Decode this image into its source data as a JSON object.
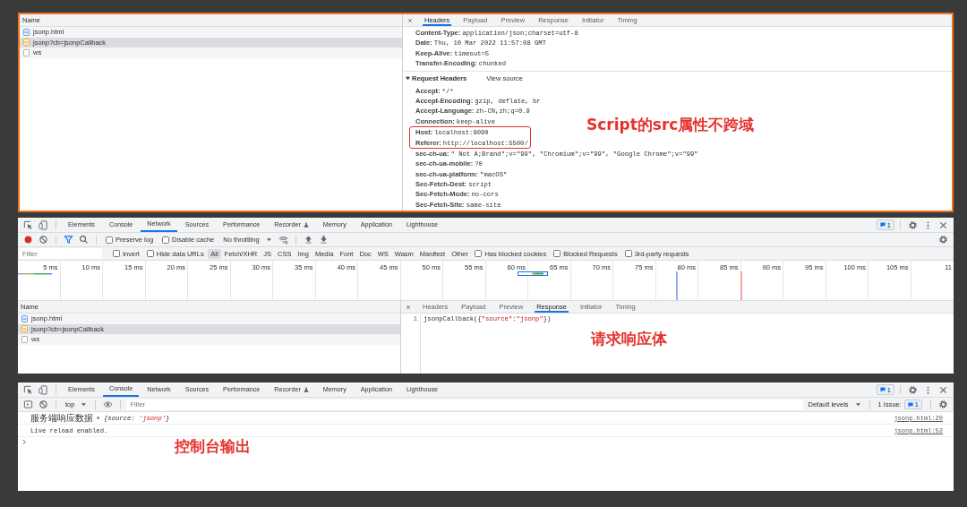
{
  "top_panel": {
    "requests": {
      "column": "Name",
      "items": [
        {
          "name": "jsonp.html",
          "kind": "document",
          "selected": false
        },
        {
          "name": "jsonp?cb=jsonpCallback",
          "kind": "script",
          "selected": true
        },
        {
          "name": "ws",
          "kind": "other",
          "selected": false
        }
      ]
    },
    "detail": {
      "tabs": [
        {
          "label": "Headers",
          "selected": true
        },
        {
          "label": "Payload",
          "selected": false
        },
        {
          "label": "Preview",
          "selected": false
        },
        {
          "label": "Response",
          "selected": false
        },
        {
          "label": "Initiator",
          "selected": false
        },
        {
          "label": "Timing",
          "selected": false
        }
      ],
      "response_headers": [
        {
          "name": "Content-Type:",
          "value": "application/json;charset=utf-8"
        },
        {
          "name": "Date:",
          "value": "Thu, 10 Mar 2022 11:57:08 GMT"
        },
        {
          "name": "Keep-Alive:",
          "value": "timeout=5"
        },
        {
          "name": "Transfer-Encoding:",
          "value": "chunked"
        }
      ],
      "request_headers": {
        "title": "Request Headers",
        "expanded": true,
        "view_source": "View source",
        "items": [
          {
            "name": "Accept:",
            "value": "*/*",
            "highlighted": false
          },
          {
            "name": "Accept-Encoding:",
            "value": "gzip, deflate, br",
            "highlighted": false
          },
          {
            "name": "Accept-Language:",
            "value": "zh-CN,zh;q=0.9",
            "highlighted": false
          },
          {
            "name": "Connection:",
            "value": "keep-alive",
            "highlighted": false
          },
          {
            "name": "Host:",
            "value": "localhost:8090",
            "highlighted": true
          },
          {
            "name": "Referer:",
            "value": "http://localhost:5500/",
            "highlighted": true
          },
          {
            "name": "sec-ch-ua:",
            "value": "\" Not A;Brand\";v=\"99\", \"Chromium\";v=\"99\", \"Google Chrome\";v=\"99\"",
            "highlighted": false
          },
          {
            "name": "sec-ch-ua-mobile:",
            "value": "?0",
            "highlighted": false
          },
          {
            "name": "sec-ch-ua-platform:",
            "value": "\"macOS\"",
            "highlighted": false
          },
          {
            "name": "Sec-Fetch-Dest:",
            "value": "script",
            "highlighted": false
          },
          {
            "name": "Sec-Fetch-Mode:",
            "value": "no-cors",
            "highlighted": false
          },
          {
            "name": "Sec-Fetch-Site:",
            "value": "same-site",
            "highlighted": false
          }
        ]
      }
    },
    "annotation": "Script的src属性不跨域"
  },
  "network_panel": {
    "devtools_tabs": [
      {
        "label": "Elements",
        "selected": false,
        "experimental": false
      },
      {
        "label": "Console",
        "selected": false,
        "experimental": false
      },
      {
        "label": "Network",
        "selected": true,
        "experimental": false
      },
      {
        "label": "Sources",
        "selected": false,
        "experimental": false
      },
      {
        "label": "Performance",
        "selected": false,
        "experimental": false
      },
      {
        "label": "Recorder",
        "selected": false,
        "experimental": true
      },
      {
        "label": "Memory",
        "selected": false,
        "experimental": false
      },
      {
        "label": "Application",
        "selected": false,
        "experimental": false
      },
      {
        "label": "Lighthouse",
        "selected": false,
        "experimental": false
      }
    ],
    "issues_count": "1",
    "toolbar": {
      "recording": true,
      "checkboxes": [
        {
          "label": "Preserve log",
          "checked": false
        },
        {
          "label": "Disable cache",
          "checked": false
        }
      ],
      "throttling": "No throttling"
    },
    "filter_bar": {
      "placeholder": "Filter",
      "options_before": [
        {
          "label": "Invert",
          "checked": false
        },
        {
          "label": "Hide data URLs",
          "checked": false
        }
      ],
      "types": [
        {
          "label": "All",
          "selected": true
        },
        {
          "label": "Fetch/XHR",
          "selected": false
        },
        {
          "label": "JS",
          "selected": false
        },
        {
          "label": "CSS",
          "selected": false
        },
        {
          "label": "Img",
          "selected": false
        },
        {
          "label": "Media",
          "selected": false
        },
        {
          "label": "Font",
          "selected": false
        },
        {
          "label": "Doc",
          "selected": false
        },
        {
          "label": "WS",
          "selected": false
        },
        {
          "label": "Wasm",
          "selected": false
        },
        {
          "label": "Manifest",
          "selected": false
        },
        {
          "label": "Other",
          "selected": false
        }
      ],
      "options_after": [
        {
          "label": "Has blocked cookies",
          "checked": false
        },
        {
          "label": "Blocked Requests",
          "checked": false
        },
        {
          "label": "3rd-party requests",
          "checked": false
        }
      ]
    },
    "timeline": {
      "ticks": [
        "5 ms",
        "10 ms",
        "15 ms",
        "20 ms",
        "25 ms",
        "30 ms",
        "35 ms",
        "40 ms",
        "45 ms",
        "50 ms",
        "55 ms",
        "60 ms",
        "65 ms",
        "70 ms",
        "75 ms",
        "80 ms",
        "85 ms",
        "90 ms",
        "95 ms",
        "100 ms",
        "105 ms",
        "11"
      ]
    },
    "requests": {
      "column": "Name",
      "items": [
        {
          "name": "jsonp.html",
          "kind": "document",
          "selected": false
        },
        {
          "name": "jsonp?cb=jsonpCallback",
          "kind": "script",
          "selected": true
        },
        {
          "name": "ws",
          "kind": "other",
          "selected": false
        }
      ]
    },
    "detail": {
      "tabs": [
        {
          "label": "Headers",
          "selected": false
        },
        {
          "label": "Payload",
          "selected": false
        },
        {
          "label": "Preview",
          "selected": false
        },
        {
          "label": "Response",
          "selected": true
        },
        {
          "label": "Initiator",
          "selected": false
        },
        {
          "label": "Timing",
          "selected": false
        }
      ],
      "line_number": "1",
      "code": [
        {
          "text": "jsonpCallback({",
          "kind": "plain"
        },
        {
          "text": "\"source\"",
          "kind": "string"
        },
        {
          "text": ":",
          "kind": "plain"
        },
        {
          "text": "\"jsonp\"",
          "kind": "string"
        },
        {
          "text": "})",
          "kind": "plain"
        }
      ]
    },
    "annotation": "请求响应体"
  },
  "console_panel": {
    "devtools_tabs": [
      {
        "label": "Elements",
        "selected": false,
        "experimental": false
      },
      {
        "label": "Console",
        "selected": true,
        "experimental": false
      },
      {
        "label": "Network",
        "selected": false,
        "experimental": false
      },
      {
        "label": "Sources",
        "selected": false,
        "experimental": false
      },
      {
        "label": "Performance",
        "selected": false,
        "experimental": false
      },
      {
        "label": "Recorder",
        "selected": false,
        "experimental": true
      },
      {
        "label": "Memory",
        "selected": false,
        "experimental": false
      },
      {
        "label": "Application",
        "selected": false,
        "experimental": false
      },
      {
        "label": "Lighthouse",
        "selected": false,
        "experimental": false
      }
    ],
    "issues_count": "1",
    "toolbar": {
      "context": "top",
      "filter_placeholder": "Filter",
      "levels": "Default levels",
      "issues_label": "1 Issue:",
      "issues_count": "1"
    },
    "messages": [
      {
        "kind": "object",
        "text": "服务端响应数据",
        "object": {
          "open": "{source: ",
          "value": "'jsonp'",
          "close": "}"
        },
        "source": "jsonp.html:20"
      },
      {
        "kind": "text",
        "text": "Live reload enabled.",
        "source": "jsonp.html:52"
      }
    ],
    "annotation": "控制台输出"
  }
}
